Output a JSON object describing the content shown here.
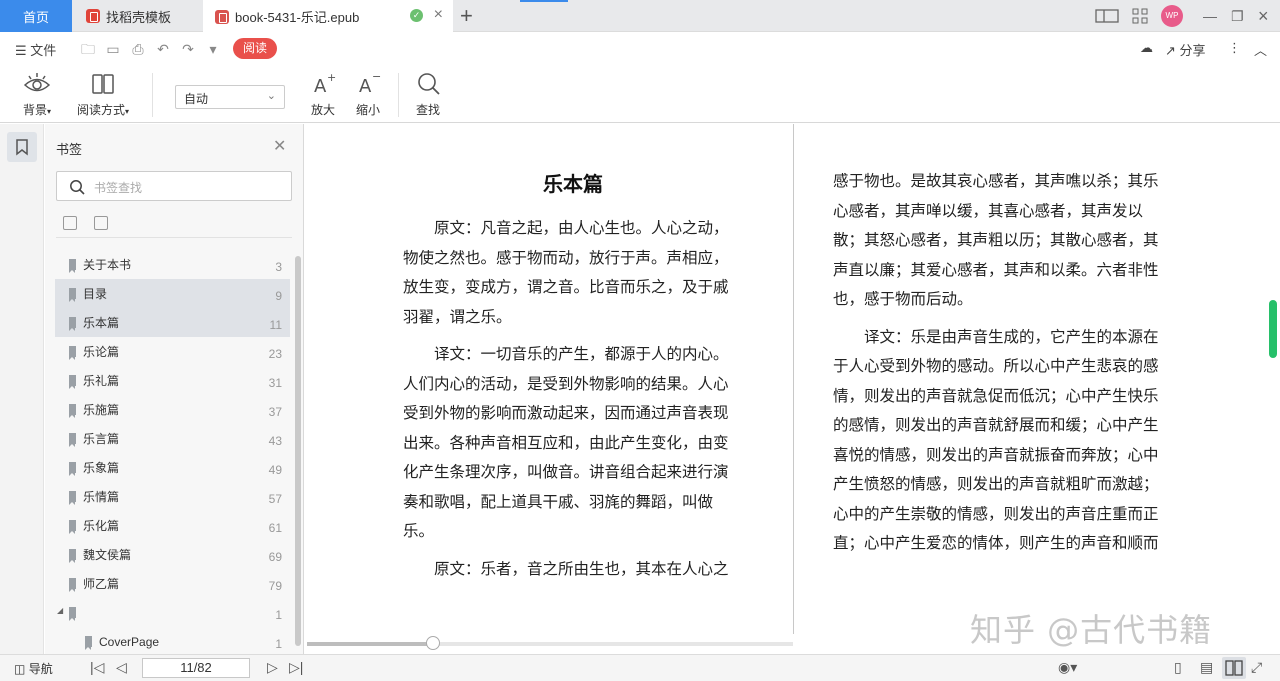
{
  "tabs": {
    "home": "首页",
    "templates": "找稻壳模板",
    "book": "book-5431-乐记.epub",
    "avatar_text": "WP"
  },
  "menu": {
    "file": "文件",
    "read": "阅读",
    "share": "分享"
  },
  "ribbon": {
    "background": "背景",
    "read_mode": "阅读方式",
    "zoom_select": "自动",
    "zoom_in": "放大",
    "zoom_out": "缩小",
    "find": "查找"
  },
  "panel": {
    "title": "书签",
    "search_placeholder": "书签查找",
    "items": [
      {
        "label": "关于本书",
        "page": "3"
      },
      {
        "label": "目录",
        "page": "9"
      },
      {
        "label": "乐本篇",
        "page": "11"
      },
      {
        "label": "乐论篇",
        "page": "23"
      },
      {
        "label": "乐礼篇",
        "page": "31"
      },
      {
        "label": "乐施篇",
        "page": "37"
      },
      {
        "label": "乐言篇",
        "page": "43"
      },
      {
        "label": "乐象篇",
        "page": "49"
      },
      {
        "label": "乐情篇",
        "page": "57"
      },
      {
        "label": "乐化篇",
        "page": "61"
      },
      {
        "label": "魏文侯篇",
        "page": "69"
      },
      {
        "label": "师乙篇",
        "page": "79"
      },
      {
        "label": "",
        "page": "1"
      },
      {
        "label": "CoverPage",
        "page": "1"
      }
    ]
  },
  "book": {
    "chapter_title": "乐本篇",
    "left_paragraphs": [
      "原文：凡音之起，由人心生也。人心之动，物使之然也。感于物而动，放行于声。声相应，放生变，变成方，谓之音。比音而乐之，及于戚羽翟，谓之乐。",
      "译文：一切音乐的产生，都源于人的内心。人们内心的活动，是受到外物影响的结果。人心受到外物的影响而激动起来，因而通过声音表现出来。各种声音相互应和，由此产生变化，由变化产生条理次序，叫做音。讲音组合起来进行演奏和歌唱，配上道具干戚、羽旄的舞蹈，叫做乐。",
      "原文：乐者，音之所由生也，其本在人心之"
    ],
    "right_paragraphs": [
      "感于物也。是故其哀心感者，其声噍以杀；其乐心感者，其声啴以缓，其喜心感者，其声发以散；其怒心感者，其声粗以历；其散心感者，其声直以廉；其爱心感者，其声和以柔。六者非性也，感于物而后动。",
      "译文：乐是由声音生成的，它产生的本源在于人心受到外物的感动。所以心中产生悲哀的感情，则发出的声音就急促而低沉；心中产生快乐的感情，则发出的声音就舒展而和缓；心中产生喜悦的情感，则发出的声音就振奋而奔放；心中产生愤怒的情感，则发出的声音就粗旷而激越；心中的产生崇敬的情感，则发出的声音庄重而正直；心中产生爱恋的情体，则产生的声音和顺而"
    ],
    "progress_fraction": 0.26
  },
  "watermark": "知乎 @古代书籍",
  "statusbar": {
    "nav": "导航",
    "page_indicator": "11/82"
  }
}
